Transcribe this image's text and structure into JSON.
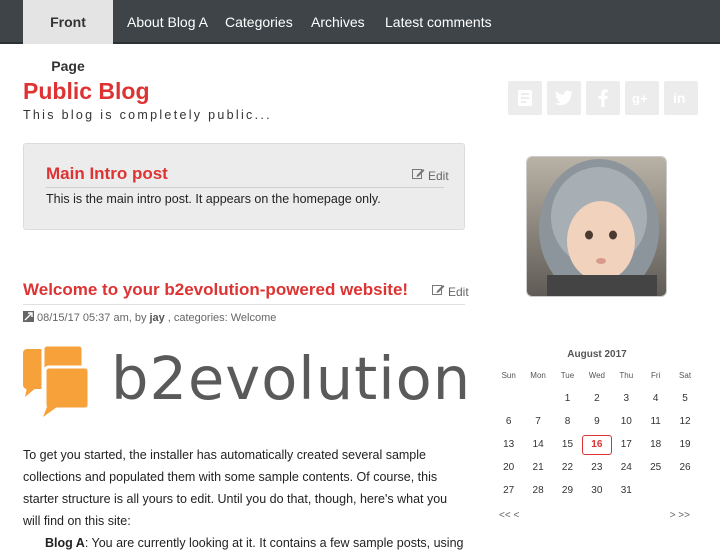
{
  "nav": {
    "items": [
      "Front Page",
      "About Blog A",
      "Categories",
      "Archives",
      "Latest comments"
    ]
  },
  "blog": {
    "title": "Public Blog",
    "tagline": "This blog is completely public..."
  },
  "social_icons": [
    "blog-icon",
    "twitter-icon",
    "facebook-icon",
    "google-plus-icon",
    "linkedin-icon"
  ],
  "intro": {
    "title": "Main Intro post",
    "edit_label": "Edit",
    "text": "This is the main intro post. It appears on the homepage only."
  },
  "post": {
    "title": "Welcome to your b2evolution-powered website!",
    "edit_label": "Edit",
    "meta_date": "08/15/17 05:37 am, by ",
    "meta_author": "jay",
    "meta_categories": ", categories: Welcome",
    "logo_text": "b2evolution",
    "paragraph": "To get you started, the installer has automatically created several sample collections and populated them with some sample contents. Of course, this starter structure is all yours to edit. Until you do that, though, here's what you will find on this site:",
    "list_item_label": "Blog A",
    "list_item_text": ": You are currently looking at it. It contains a few sample posts, using"
  },
  "calendar": {
    "title": "August 2017",
    "weekdays": [
      "Sun",
      "Mon",
      "Tue",
      "Wed",
      "Thu",
      "Fri",
      "Sat"
    ],
    "weeks": [
      [
        "",
        "",
        "1",
        "2",
        "3",
        "4",
        "5"
      ],
      [
        "6",
        "7",
        "8",
        "9",
        "10",
        "11",
        "12"
      ],
      [
        "13",
        "14",
        "15",
        "16",
        "17",
        "18",
        "19"
      ],
      [
        "20",
        "21",
        "22",
        "23",
        "24",
        "25",
        "26"
      ],
      [
        "27",
        "28",
        "29",
        "30",
        "31",
        "",
        ""
      ]
    ],
    "today": "16",
    "prev_label": "<<  <",
    "next_label": ">  >>"
  },
  "colors": {
    "accent": "#dd3333",
    "nav_bg": "#3e4448",
    "logo_orange": "#f7a13b",
    "logo_gray": "#5a5a5a"
  }
}
